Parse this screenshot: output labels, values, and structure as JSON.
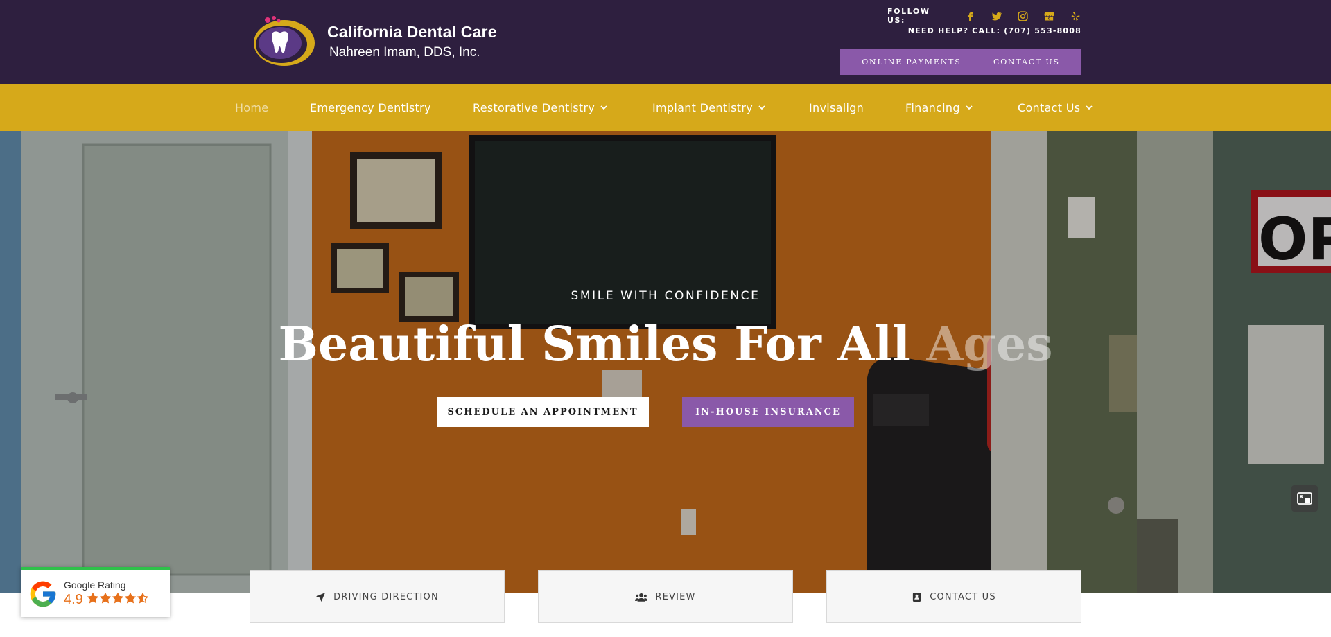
{
  "colors": {
    "header_bg": "#2e1f3f",
    "nav_bg": "#d6a91a",
    "accent_purple": "#8a59a9",
    "social_icon": "#d6a91a",
    "rating_orange": "#e7711b",
    "rating_bar": "#2ec24a"
  },
  "brand": {
    "name": "California Dental Care",
    "subtitle": "Nahreen Imam, DDS, Inc."
  },
  "header": {
    "follow_label": "FOLLOW US:",
    "social_icons": [
      "facebook-icon",
      "twitter-icon",
      "instagram-icon",
      "google-my-business-icon",
      "yelp-icon"
    ],
    "help_text": "NEED HELP? CALL: (707) 553-8008",
    "buttons": {
      "online_payments": "ONLINE PAYMENTS",
      "contact_us": "CONTACT US"
    }
  },
  "nav": {
    "items": [
      {
        "label": "Home",
        "active": true,
        "has_dropdown": false
      },
      {
        "label": "Emergency Dentistry",
        "active": false,
        "has_dropdown": false
      },
      {
        "label": "Restorative Dentistry",
        "active": false,
        "has_dropdown": true
      },
      {
        "label": "Implant Dentistry",
        "active": false,
        "has_dropdown": true
      },
      {
        "label": "Invisalign",
        "active": false,
        "has_dropdown": false
      },
      {
        "label": "Financing",
        "active": false,
        "has_dropdown": true
      },
      {
        "label": "Contact Us",
        "active": false,
        "has_dropdown": true
      }
    ]
  },
  "hero": {
    "kicker": "SMILE WITH CONFIDENCE",
    "title_solid": "Beautiful Smiles For All ",
    "title_faded": "Ages",
    "schedule_button": "SCHEDULE AN APPOINTMENT",
    "insurance_button": "IN-HOUSE INSURANCE",
    "pip_icon": "picture-in-picture-icon"
  },
  "cards": {
    "driving": {
      "label": "DRIVING DIRECTION",
      "icon": "location-arrow-icon"
    },
    "review": {
      "label": "REVIEW",
      "icon": "users-icon"
    },
    "contact": {
      "label": "CONTACT US",
      "icon": "contact-card-icon"
    }
  },
  "google_rating": {
    "label": "Google Rating",
    "value": "4.9",
    "stars": 4.9
  }
}
